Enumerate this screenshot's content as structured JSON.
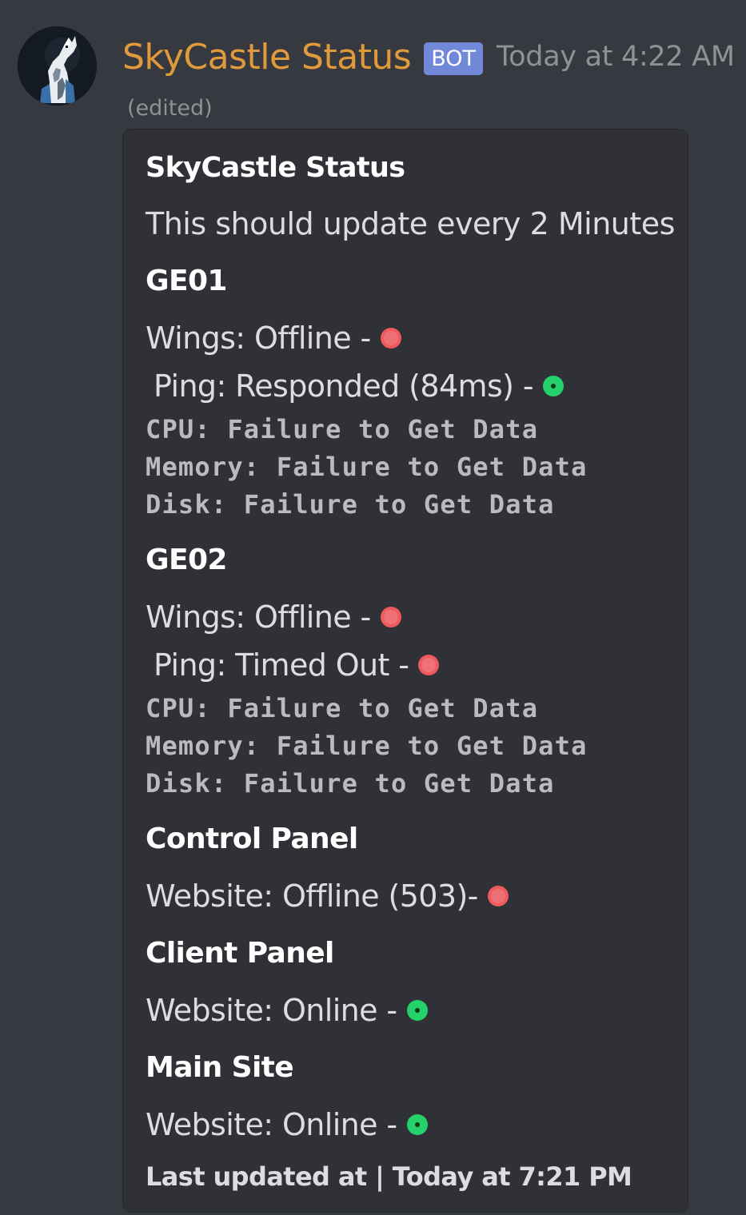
{
  "message": {
    "author": "SkyCastle Status",
    "bot_tag": "BOT",
    "timestamp": "Today at 4:22 AM",
    "edited": "(edited)",
    "avatar_icon": "howling-wolf-icon"
  },
  "embed": {
    "title": "SkyCastle Status",
    "description": "This should update every 2 Minutes",
    "geo1": {
      "name": "GE01",
      "wings": "Wings: Offline -",
      "wings_status": "offline",
      "ping": "Ping: Responded (84ms) -",
      "ping_status": "online",
      "cpu": "CPU: Failure to Get Data",
      "memory": "Memory: Failure to Get Data",
      "disk": "Disk: Failure to Get Data"
    },
    "geo2": {
      "name": "GE02",
      "wings": "Wings: Offline -",
      "wings_status": "offline",
      "ping": "Ping: Timed Out -",
      "ping_status": "offline",
      "cpu": "CPU: Failure to Get Data",
      "memory": "Memory: Failure to Get Data",
      "disk": "Disk: Failure to Get Data"
    },
    "control_panel": {
      "name": "Control Panel",
      "website": "Website: Offline (503)-",
      "status": "offline"
    },
    "client_panel": {
      "name": "Client Panel",
      "website": "Website: Online -",
      "status": "online"
    },
    "main_site": {
      "name": "Main Site",
      "website": "Website: Online -",
      "status": "online"
    },
    "footer": "Last updated at | Today at 7:21 PM"
  },
  "colors": {
    "background": "#36393f",
    "embed_background": "#2f3136",
    "author_name": "#e09a3c",
    "bot_tag": "#7289da",
    "status_offline": "#f05a5e",
    "status_online": "#24d16a"
  }
}
